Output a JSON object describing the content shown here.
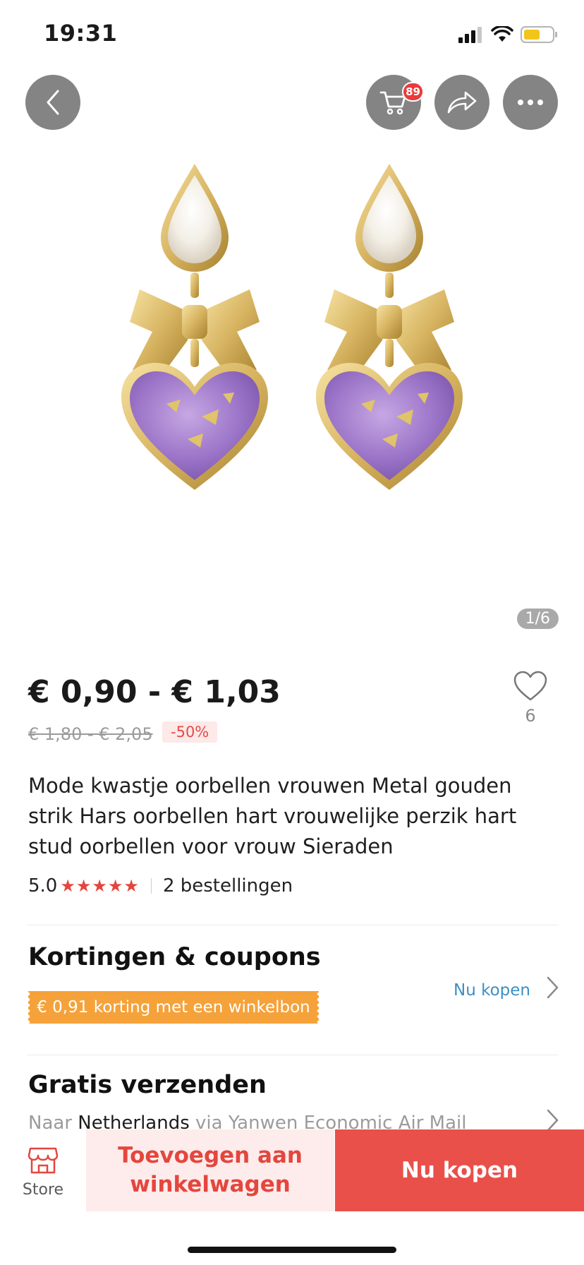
{
  "status_bar": {
    "time": "19:31"
  },
  "header": {
    "cart_badge": "89"
  },
  "gallery": {
    "counter": "1/6"
  },
  "price": {
    "range": "€ 0,90 - € 1,03",
    "original": "€ 1,80 - € 2,05",
    "discount": "-50%"
  },
  "wishlist": {
    "count": "6"
  },
  "product": {
    "title": "Mode kwastje oorbellen vrouwen Metal gouden strik Hars oorbellen hart vrouwelijke perzik hart stud oorbellen voor vrouw Sieraden",
    "rating": "5.0",
    "stars": "★★★★★",
    "orders": "2 bestellingen"
  },
  "discounts": {
    "title": "Kortingen & coupons",
    "coupon": "€ 0,91 korting met een winkelbon",
    "link": "Nu kopen"
  },
  "shipping": {
    "title": "Gratis verzenden",
    "prefix": "Naar",
    "country": "Netherlands",
    "carrier": "via Yanwen Economic Air Mail"
  },
  "bottom_bar": {
    "store_label": "Store",
    "add_to_cart": "Toevoegen aan winkelwagen",
    "buy_now": "Nu kopen"
  },
  "colors": {
    "accent_red": "#e9504a",
    "coupon_orange": "#f5a23a",
    "link_blue": "#3d8fc6"
  }
}
